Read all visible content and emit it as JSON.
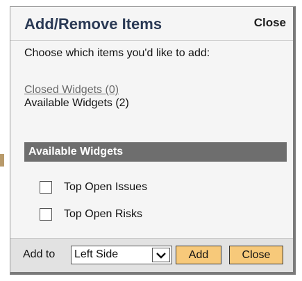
{
  "dialog": {
    "title": "Add/Remove Items",
    "close_link": "Close",
    "instruction": "Choose which items you'd like to add:",
    "closed_widgets_link": "Closed Widgets (0)",
    "available_widgets_text": "Available Widgets (2)",
    "section_header": "Available Widgets",
    "widgets": [
      {
        "label": "Top Open Issues",
        "checked": false
      },
      {
        "label": "Top Open Risks",
        "checked": false
      }
    ]
  },
  "footer": {
    "add_to_label": "Add to",
    "select_value": "Left Side",
    "add_button": "Add",
    "close_button": "Close"
  },
  "colors": {
    "title": "#2b3a55",
    "section_bar": "#6e6e6e",
    "button": "#f7c97a",
    "footer_bg": "#e2e2e2"
  }
}
